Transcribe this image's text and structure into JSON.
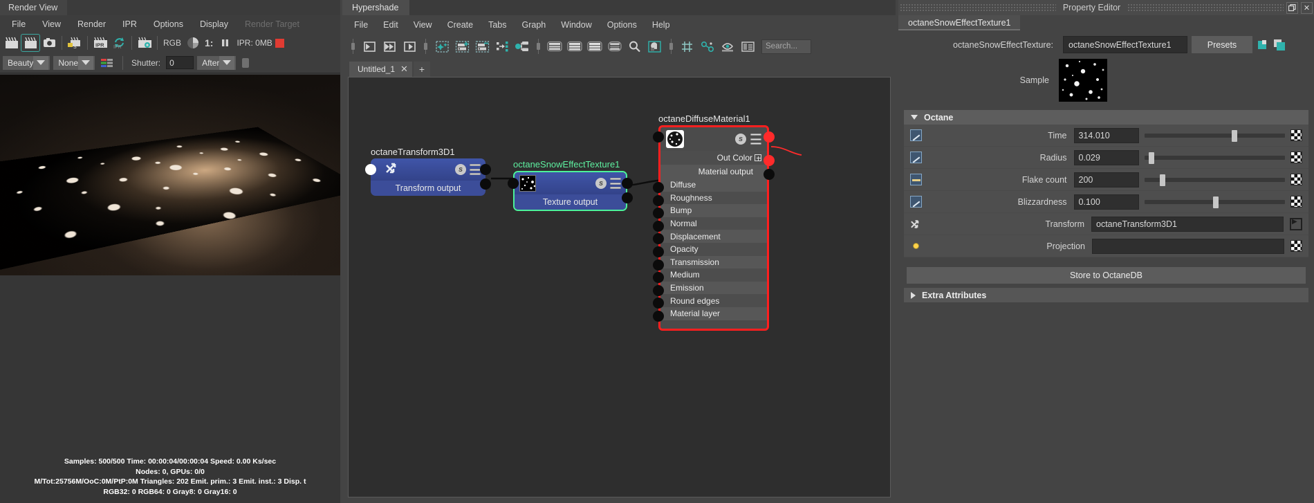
{
  "render_view": {
    "title": "Render View",
    "menus": [
      {
        "label": "File",
        "disabled": false
      },
      {
        "label": "View",
        "disabled": false
      },
      {
        "label": "Render",
        "disabled": false
      },
      {
        "label": "IPR",
        "disabled": false
      },
      {
        "label": "Options",
        "disabled": false
      },
      {
        "label": "Display",
        "disabled": false
      },
      {
        "label": "Render Target",
        "disabled": true
      }
    ],
    "toolbar": {
      "icons": [
        "render-clapper-icon",
        "render-region-icon",
        "snapshot-camera-icon",
        "render-sequence-icon",
        "ipr-render-icon",
        "ipr-refresh-icon",
        "render-settings-icon"
      ],
      "rgb_label": "RGB",
      "exposure_icon": "exposure-wedge-icon",
      "scale_label": "1:",
      "pause_icon": "pause-icon",
      "ipr_label": "IPR: 0MB",
      "swatch_color": "#e03b32"
    },
    "toolbar2": {
      "aov_value": "Beauty",
      "camera_value": "None",
      "channel_icon": "rgb-channels-icon",
      "shutter_label": "Shutter:",
      "shutter_value": "0",
      "after_value": "After"
    },
    "status_lines": [
      "Samples: 500/500 Time: 00:00:04/00:00:04 Speed: 0.00 Ks/sec",
      "Nodes: 0, GPUs: 0/0",
      "M/Tot:25756M/OoC:0M/PtP:0M Triangles: 202 Emit. prim.: 3 Emit. inst.: 3 Disp. t",
      "RGB32: 0 RGB64: 0 Gray8: 0 Gray16: 0"
    ]
  },
  "hypershade": {
    "title": "Hypershade",
    "menus": [
      {
        "label": "File"
      },
      {
        "label": "Edit"
      },
      {
        "label": "View"
      },
      {
        "label": "Create"
      },
      {
        "label": "Tabs"
      },
      {
        "label": "Graph"
      },
      {
        "label": "Window"
      },
      {
        "label": "Options"
      },
      {
        "label": "Help"
      }
    ],
    "toolbar_icons": [
      "graph-input-connections-icon",
      "graph-input-output-connections-icon",
      "graph-output-connections-icon",
      "rearrange-graph-icon",
      "add-selected-to-graph-icon",
      "remove-selected-from-graph-icon",
      "show-upstream-icon",
      "show-downstream-icon",
      "display-as-small-swatches-icon",
      "display-as-medium-swatches-icon",
      "display-as-large-swatches-icon",
      "display-as-list-icon",
      "search-icon",
      "render-swatch-icon",
      "grid-snap-icon",
      "connected-nodes-icon",
      "hide-attributes-icon",
      "show-attributes-icon"
    ],
    "search_placeholder": "Search...",
    "doc_tab": "Untitled_1",
    "add_tab_label": "+",
    "nodes": [
      {
        "name": "octaneTransform3D1",
        "title_color": "#e8e8e8",
        "output_label": "Transform output",
        "icon": "transform-3d-icon"
      },
      {
        "name": "octaneSnowEffectTexture1",
        "title_color": "#5ef0a0",
        "output_label": "Texture output",
        "icon": "snow-texture-swatch"
      },
      {
        "name": "octaneDiffuseMaterial1",
        "title_color": "#e8e8e8",
        "out_color_label": "Out Color",
        "material_output_label": "Material output",
        "ports": [
          "Diffuse",
          "Roughness",
          "Bump",
          "Normal",
          "Displacement",
          "Opacity",
          "Transmission",
          "Medium",
          "Emission",
          "Round edges",
          "Material layer"
        ],
        "selected_color": "#ff1f1f"
      }
    ]
  },
  "property_editor": {
    "title": "Property Editor",
    "window_buttons": [
      "restore-icon",
      "close-icon"
    ],
    "tab_label": "octaneSnowEffectTexture1",
    "name_label": "octaneSnowEffectTexture:",
    "name_value": "octaneSnowEffectTexture1",
    "presets_label": "Presets",
    "header_icons": [
      "copy-tab-icon",
      "duplicate-tab-icon"
    ],
    "sample_label": "Sample",
    "section": {
      "label": "Octane",
      "expanded": true
    },
    "attributes": [
      {
        "label": "Time",
        "value": "314.010",
        "icon": "animation-curve-icon",
        "slider": 0.62,
        "has_slider": true,
        "map_icon": "texture-map-icon"
      },
      {
        "label": "Radius",
        "value": "0.029",
        "icon": "animation-curve-icon",
        "slider": 0.04,
        "has_slider": true,
        "map_icon": "texture-map-icon"
      },
      {
        "label": "Flake count",
        "value": "200",
        "icon": "integer-attr-icon",
        "slider": 0.12,
        "has_slider": true,
        "map_icon": "texture-map-icon"
      },
      {
        "label": "Blizzardness",
        "value": "0.100",
        "icon": "animation-curve-icon",
        "slider": 0.5,
        "has_slider": true,
        "map_icon": "texture-map-icon"
      },
      {
        "label": "Transform",
        "value": "octaneTransform3D1",
        "icon": "transform-3d-icon",
        "has_slider": false,
        "map_icon": "goto-input-icon"
      },
      {
        "label": "Projection",
        "value": "",
        "icon": "projection-dot-icon",
        "has_slider": false,
        "map_icon": "texture-map-icon"
      }
    ],
    "store_button": "Store to OctaneDB",
    "extra_attributes": "Extra Attributes"
  }
}
